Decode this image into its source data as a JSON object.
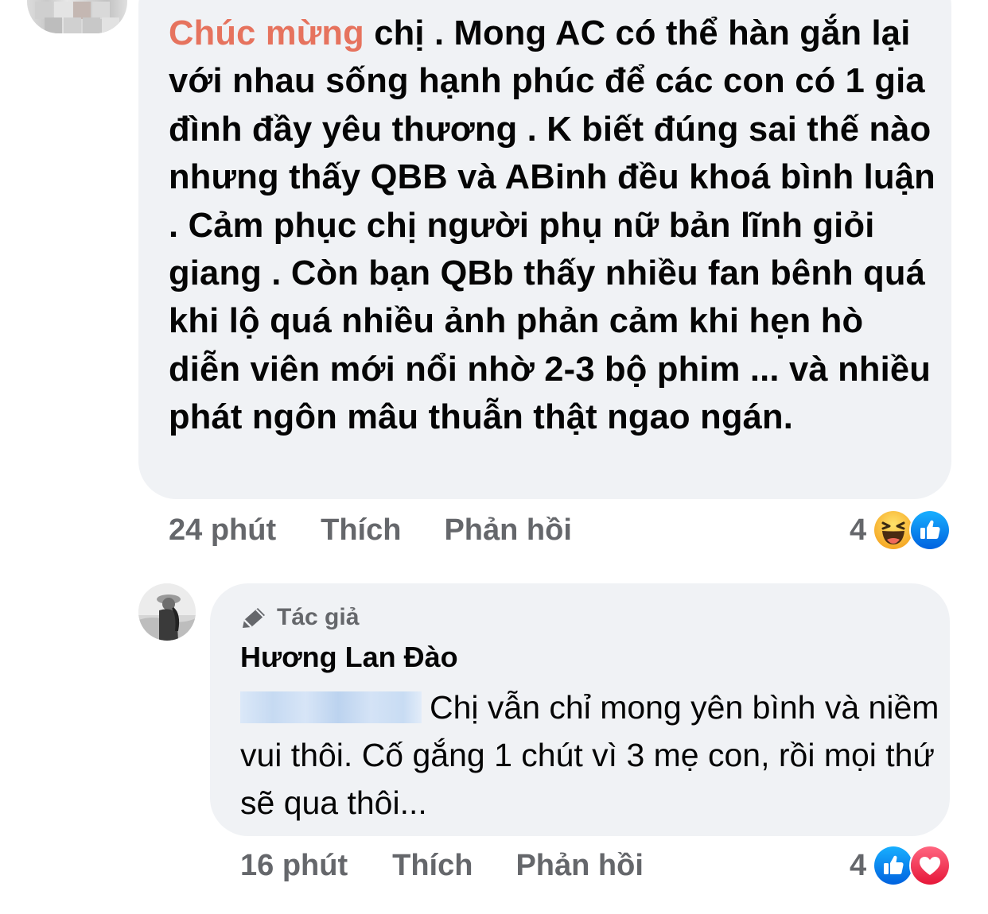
{
  "comment1": {
    "mention": "Chúc mừng",
    "text": " chị . Mong AC có thể hàn gắn lại với nhau sống hạnh phúc để các con có 1 gia đình đầy yêu thương . K biết đúng sai thế nào nhưng thấy QBB và ABinh đều khoá bình luận . Cảm phục chị người phụ nữ bản lĩnh giỏi giang . Còn bạn QBb thấy nhiều fan bênh quá khi lộ quá nhiều ảnh phản cảm khi hẹn hò diễn viên mới nổi nhờ 2-3 bộ phim ... và nhiều phát ngôn mâu thuẫn thật ngao ngán.",
    "time": "24 phút",
    "like_label": "Thích",
    "reply_label": "Phản hồi",
    "reaction_count": "4",
    "reactions": [
      "haha-icon",
      "like-icon"
    ]
  },
  "comment2": {
    "badge": "Tác giả",
    "badge_icon": "pen-icon",
    "author": "Hương Lan Đào",
    "text": "Chị vẫn chỉ mong yên bình và niềm vui thôi. Cố gắng 1 chút vì 3 mẹ con, rồi mọi thứ sẽ qua thôi...",
    "time": "16 phút",
    "like_label": "Thích",
    "reply_label": "Phản hồi",
    "reaction_count": "4",
    "reactions": [
      "like-icon",
      "love-icon"
    ]
  },
  "colors": {
    "bubble": "#f0f2f5",
    "meta_text": "#65676b",
    "mention": "#e6735e",
    "like_blue": "#1877f2",
    "love_red": "#f33e58",
    "haha_yellow": "#f7b125"
  }
}
